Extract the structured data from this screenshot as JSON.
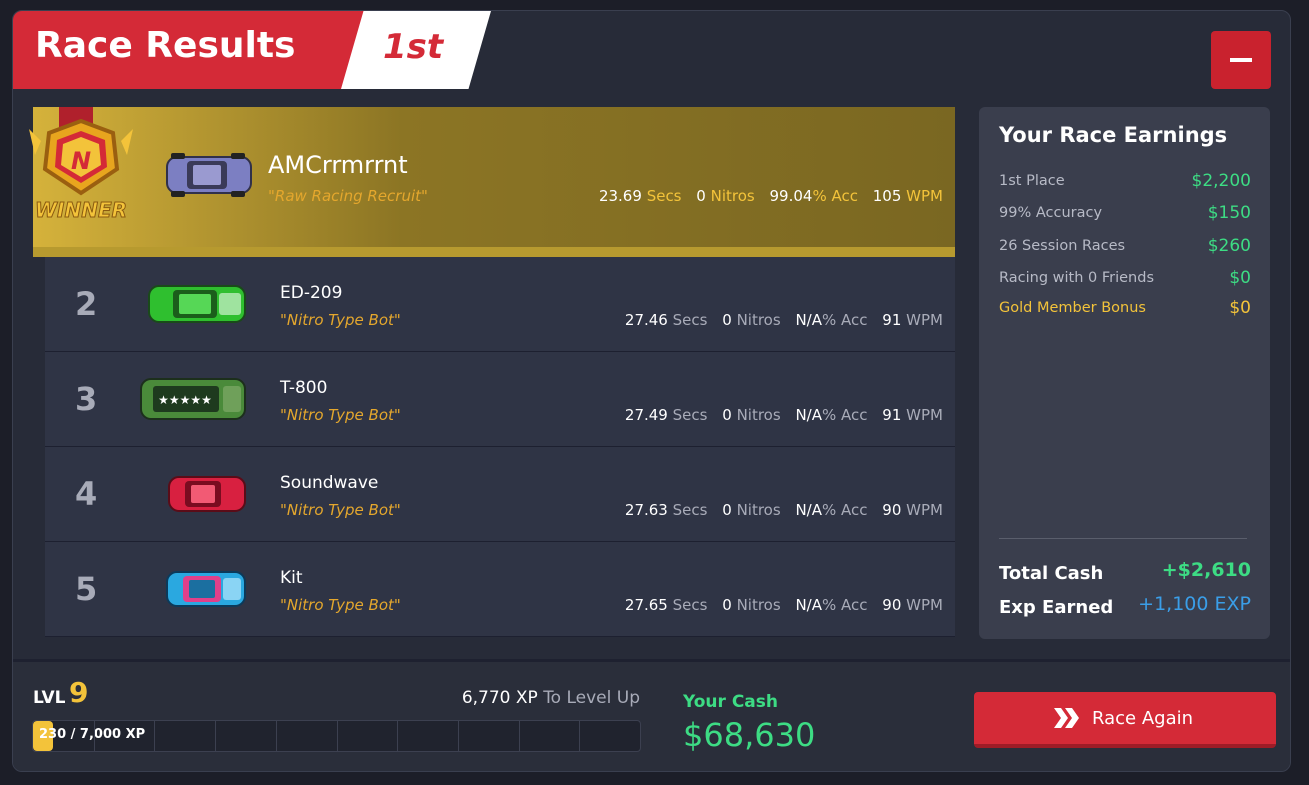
{
  "header": {
    "title": "Race Results",
    "place": "1st"
  },
  "results": [
    {
      "pos": "",
      "name": "AMCrrmrrnt",
      "title": "\"Raw Racing Recruit\"",
      "secs": "23.69",
      "nitros": "0",
      "acc": "99.04",
      "wpm": "105",
      "winner_label": "WINNER",
      "car_color": "#7c7fc2"
    },
    {
      "pos": "2",
      "name": "ED-209",
      "title": "\"Nitro Type Bot\"",
      "secs": "27.46",
      "nitros": "0",
      "acc": "N/A",
      "wpm": "91",
      "car_color": "#2fbf2f"
    },
    {
      "pos": "3",
      "name": "T-800",
      "title": "\"Nitro Type Bot\"",
      "secs": "27.49",
      "nitros": "0",
      "acc": "N/A",
      "wpm": "91",
      "car_color": "#4a8a3a"
    },
    {
      "pos": "4",
      "name": "Soundwave",
      "title": "\"Nitro Type Bot\"",
      "secs": "27.63",
      "nitros": "0",
      "acc": "N/A",
      "wpm": "90",
      "car_color": "#d82040"
    },
    {
      "pos": "5",
      "name": "Kit",
      "title": "\"Nitro Type Bot\"",
      "secs": "27.65",
      "nitros": "0",
      "acc": "N/A",
      "wpm": "90",
      "car_color": "#2aa8e0"
    }
  ],
  "units": {
    "secs": "Secs",
    "nitros": "Nitros",
    "acc": "% Acc",
    "wpm": "WPM"
  },
  "earnings": {
    "title": "Your Race Earnings",
    "rows": [
      {
        "label": "1st Place",
        "value": "$2,200"
      },
      {
        "label": "99% Accuracy",
        "value": "$150"
      },
      {
        "label": "26 Session Races",
        "value": "$260"
      },
      {
        "label": "Racing with 0 Friends",
        "value": "$0"
      },
      {
        "label": "Gold Member Bonus",
        "value": "$0"
      }
    ],
    "total_label": "Total Cash",
    "total_value": "+$2,610",
    "exp_label": "Exp Earned",
    "exp_value": "+1,100 EXP"
  },
  "footer": {
    "lvl_label": "LVL",
    "lvl": "9",
    "xp_to_level_value": "6,770 XP",
    "xp_to_level_text": "To Level Up",
    "xp_progress_text": "230 / 7,000 XP",
    "xp_fraction": 0.033,
    "cash_label": "Your Cash",
    "cash_value": "$68,630",
    "race_again_label": "Race Again"
  },
  "colors": {
    "red": "#d42a37",
    "gold": "#f3c33a",
    "green": "#3ddc84",
    "blue": "#3a9ee8"
  }
}
